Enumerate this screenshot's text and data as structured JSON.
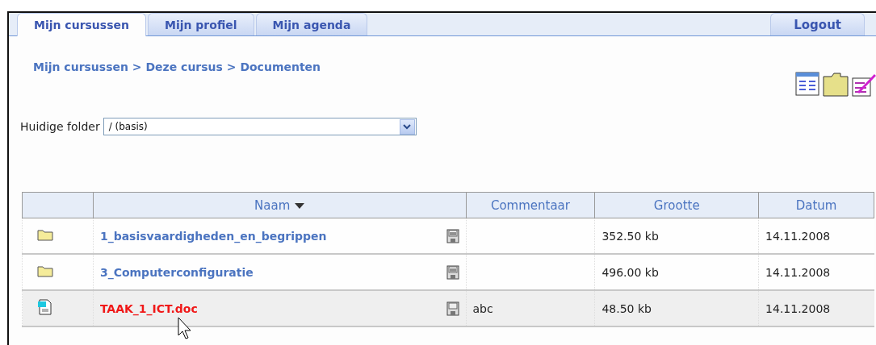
{
  "tabs": [
    {
      "label": "Mijn cursussen",
      "selected": true
    },
    {
      "label": "Mijn profiel",
      "selected": false
    },
    {
      "label": "Mijn agenda",
      "selected": false
    }
  ],
  "logout": "Logout",
  "breadcrumb": [
    "Mijn cursussen",
    "Deze cursus",
    "Documenten"
  ],
  "breadcrumb_separator": ">",
  "folder_select": {
    "label": "Huidige folder",
    "value": "/ (basis)"
  },
  "table": {
    "columns": [
      {
        "label": "Naam",
        "sorted": true
      },
      {
        "label": "Commentaar",
        "sorted": false
      },
      {
        "label": "Grootte",
        "sorted": false
      },
      {
        "label": "Datum",
        "sorted": false
      }
    ],
    "rows": [
      {
        "kind": "folder",
        "name": "1_basisvaardigheden_en_begrippen",
        "download": {
          "kind": "zip"
        },
        "size": "352.50 kb",
        "date": "14.11.2008",
        "highlighted": false
      },
      {
        "kind": "folder",
        "name": "3_Computerconfiguratie",
        "download": {
          "kind": "zip"
        },
        "size": "496.00 kb",
        "date": "14.11.2008",
        "highlighted": false
      },
      {
        "kind": "document",
        "name": "TAAK_1_ICT.doc",
        "download": {
          "kind": "save"
        },
        "comment": "abc",
        "size": "48.50 kb",
        "date": "14.11.2008",
        "highlighted": true
      }
    ]
  }
}
